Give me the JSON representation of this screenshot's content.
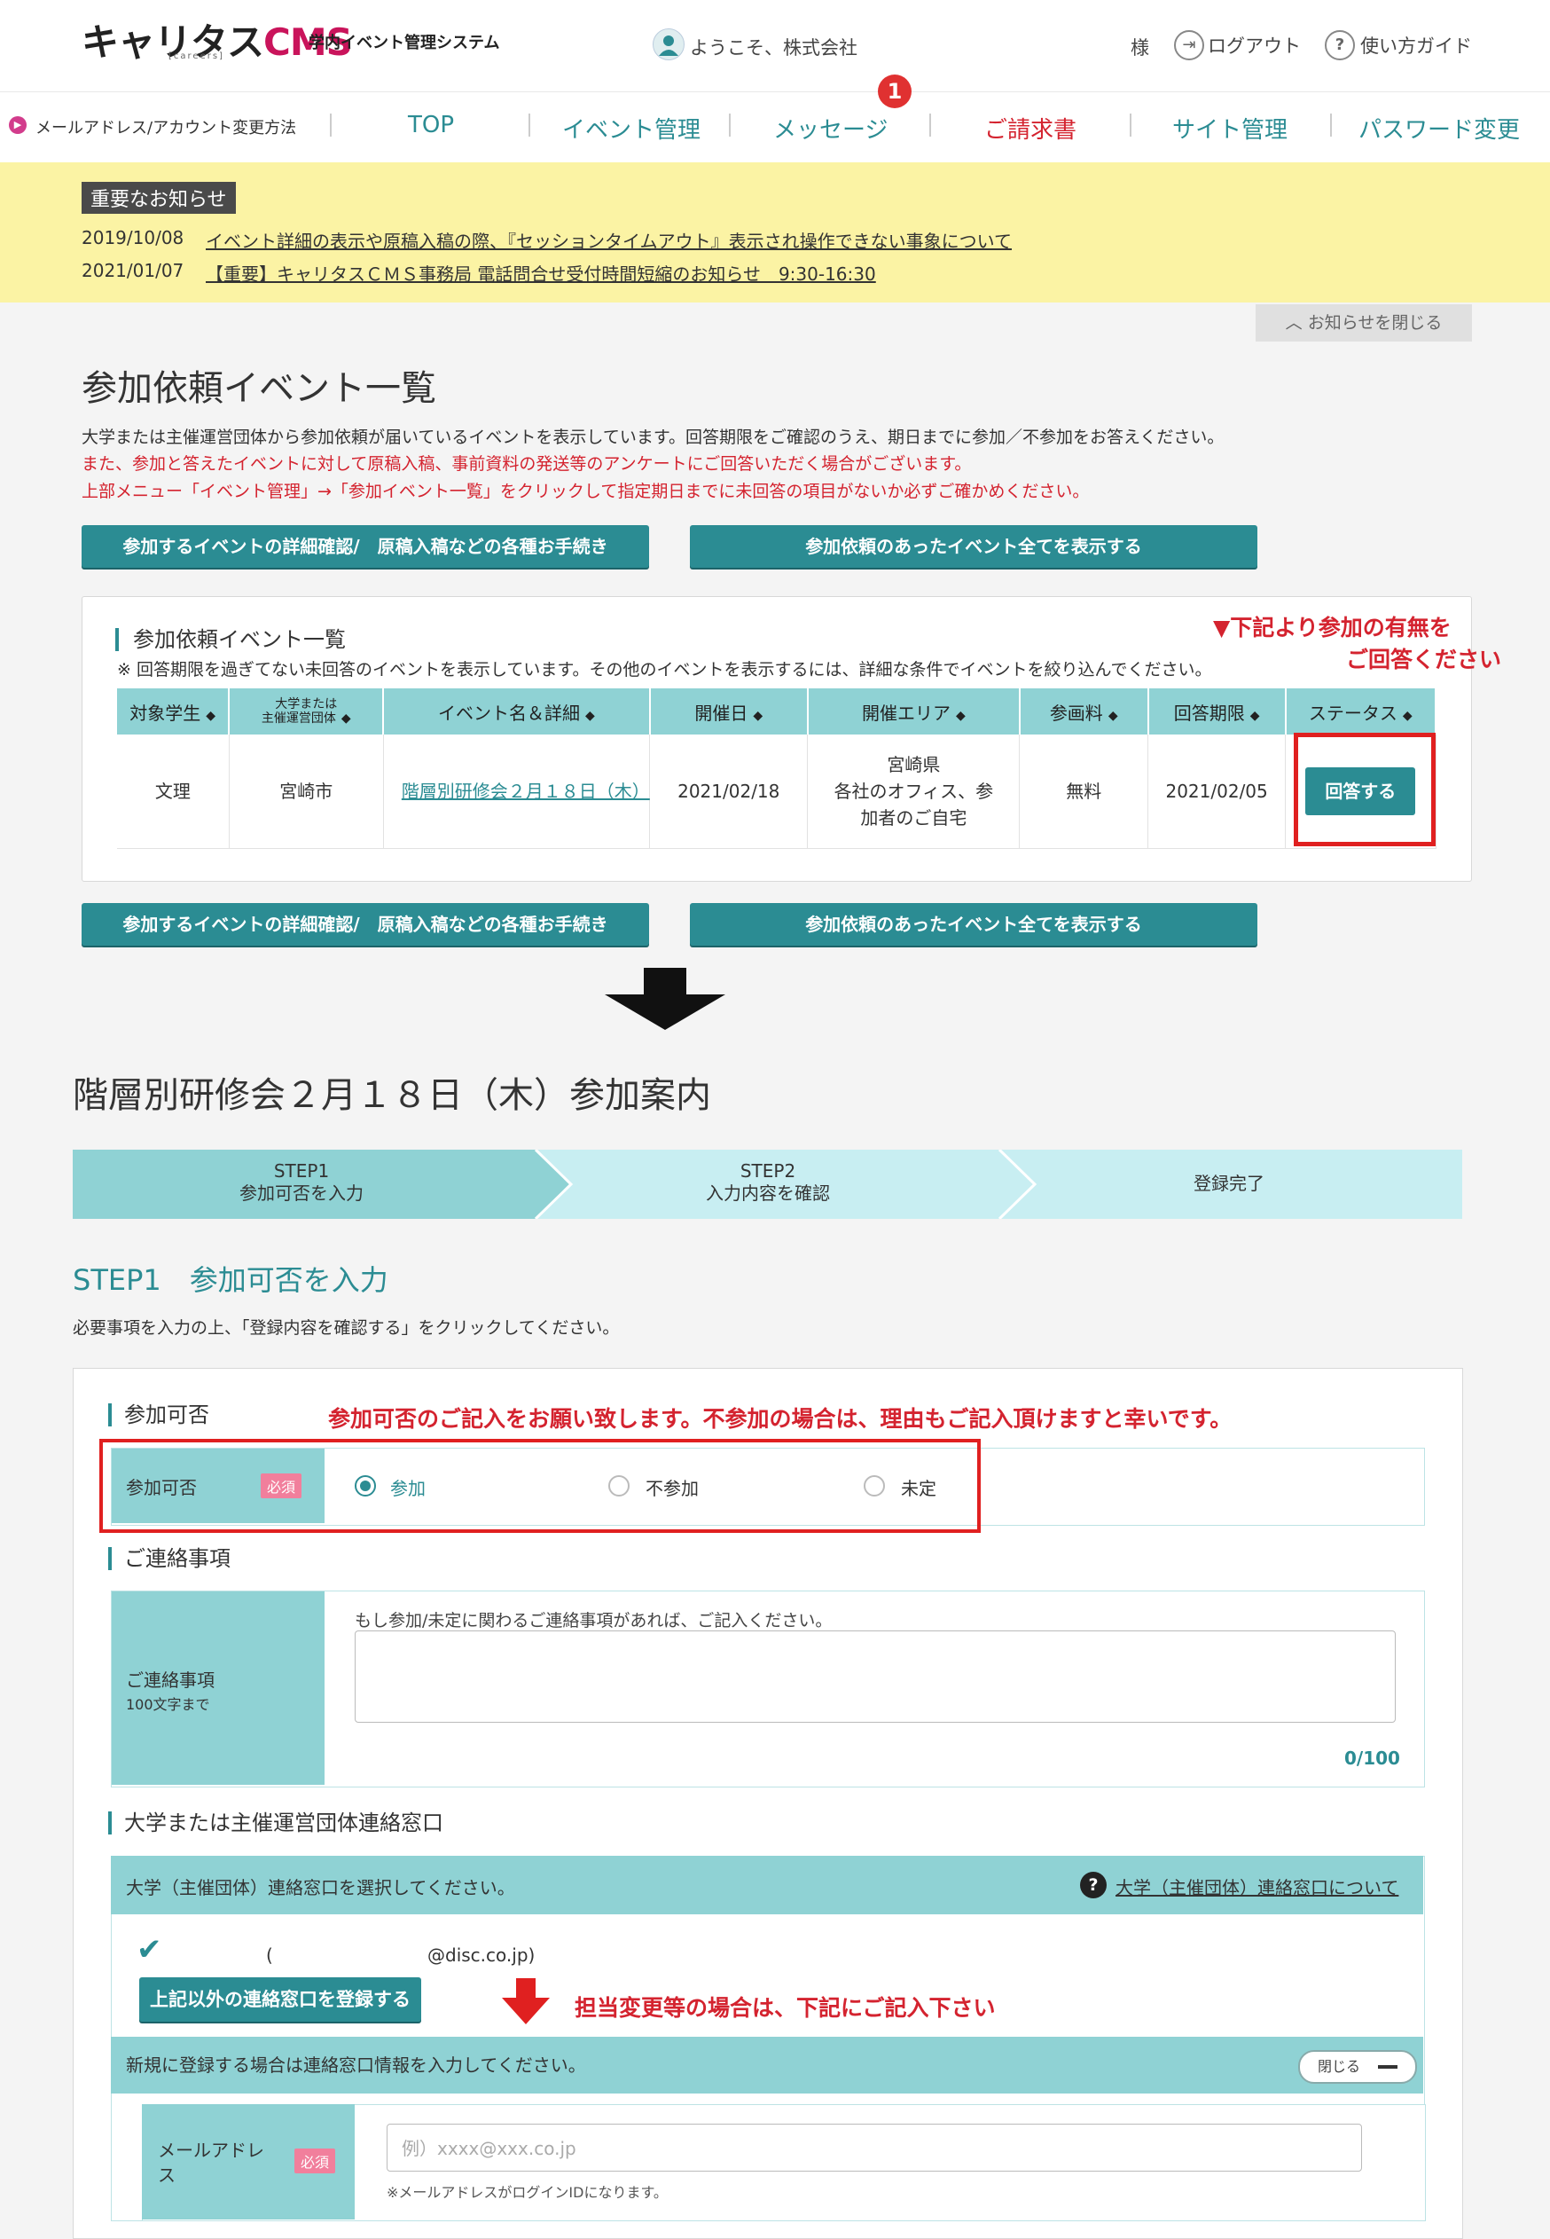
{
  "header": {
    "logo": "キャリタス",
    "logo_cms": "CMS",
    "logo_sub": "学内イベント管理システム",
    "logo_tag": "[careers]",
    "welcome": "ようこそ、株式会社",
    "sama": "様",
    "logout": "ログアウト",
    "guide": "使い方ガイド"
  },
  "nav": {
    "mail_change": "メールアドレス/アカウント変更方法",
    "items": [
      "TOP",
      "イベント管理",
      "メッセージ",
      "ご請求書",
      "サイト管理",
      "パスワード変更"
    ],
    "message_badge": "1"
  },
  "notice": {
    "title": "重要なお知らせ",
    "items": [
      {
        "date": "2019/10/08",
        "text": "イベント詳細の表示や原稿入稿の際、『セッションタイムアウト』表示され操作できない事象について"
      },
      {
        "date": "2021/01/07",
        "text": "【重要】キャリタスＣＭＳ事務局 電話問合せ受付時間短縮のお知らせ　9:30-16:30"
      }
    ],
    "close": "お知らせを閉じる"
  },
  "list_page": {
    "title": "参加依頼イベント一覧",
    "desc1": "大学または主催運営団体から参加依頼が届いているイベントを表示しています。回答期限をご確認のうえ、期日までに参加／不参加をお答えください。",
    "desc2": "また、参加と答えたイベントに対して原稿入稿、事前資料の発送等のアンケートにご回答いただく場合がございます。",
    "desc3": "上部メニュー「イベント管理」→「参加イベント一覧」をクリックして指定期日までに未回答の項目がないか必ずご確かめください。",
    "btn_details": "参加するイベントの詳細確認/　原稿入稿などの各種お手続き",
    "btn_all": "参加依頼のあったイベント全てを表示する",
    "panel_title": "参加依頼イベント一覧",
    "panel_note": "※ 回答期限を過ぎてない未回答のイベントを表示しています。その他のイベントを表示するには、詳細な条件でイベントを絞り込んでください。",
    "annotation_line1": "▼下記より参加の有無を",
    "annotation_line2": "ご回答ください",
    "columns": [
      "対象学生",
      "大学または\n主催運営団体",
      "イベント名＆詳細",
      "開催日",
      "開催エリア",
      "参画料",
      "回答期限",
      "ステータス"
    ],
    "row": {
      "target": "文理",
      "organizer": "宮崎市",
      "event_name": "階層別研修会２月１８日（木）",
      "date": "2021/02/18",
      "area": "宮崎県\n各社のオフィス、参\n加者のご自宅",
      "fee": "無料",
      "deadline": "2021/02/05",
      "status_btn": "回答する"
    }
  },
  "detail_page": {
    "title": "階層別研修会２月１８日（木）参加案内",
    "steps": [
      {
        "step": "STEP1",
        "label": "参加可否を入力"
      },
      {
        "step": "STEP2",
        "label": "入力内容を確認"
      },
      {
        "step": "",
        "label": "登録完了"
      }
    ],
    "step1_title": "STEP1　参加可否を入力",
    "step1_desc": "必要事項を入力の上、「登録内容を確認する」をクリックしてください。",
    "attendance": {
      "section": "参加可否",
      "annotation": "参加可否のご記入をお願い致します。不参加の場合は、理由もご記入頂けますと幸いです。",
      "label": "参加可否",
      "required": "必須",
      "options": [
        "参加",
        "不参加",
        "未定"
      ],
      "selected": "参加"
    },
    "contact_note": {
      "section": "ご連絡事項",
      "label": "ご連絡事項",
      "sub_label": "100文字まで",
      "instruction": "もし参加/未定に関わるご連絡事項があれば、ご記入ください。",
      "counter": "0/100"
    },
    "contact_window": {
      "section": "大学または主催運営団体連絡窓口",
      "select_text": "大学（主催団体）連絡窓口を選択してください。",
      "about_link": "大学（主催団体）連絡窓口について",
      "existing_paren": "(",
      "existing_email": "@disc.co.jp)",
      "register_btn": "上記以外の連絡窓口を登録する",
      "annotation": "担当変更等の場合は、下記にご記入下さい",
      "new_text": "新規に登録する場合は連絡窓口情報を入力してください。",
      "close": "閉じる",
      "email_label": "メールアドレス",
      "email_required": "必須",
      "email_placeholder": "例）xxxx@xxx.co.jp",
      "email_note": "※メールアドレスがログインIDになります。"
    }
  },
  "colors": {
    "teal": "#2b8c93",
    "light_teal": "#8fd2d4",
    "annotation_red": "#d4232f",
    "notice_yellow": "#fbf3a4"
  }
}
